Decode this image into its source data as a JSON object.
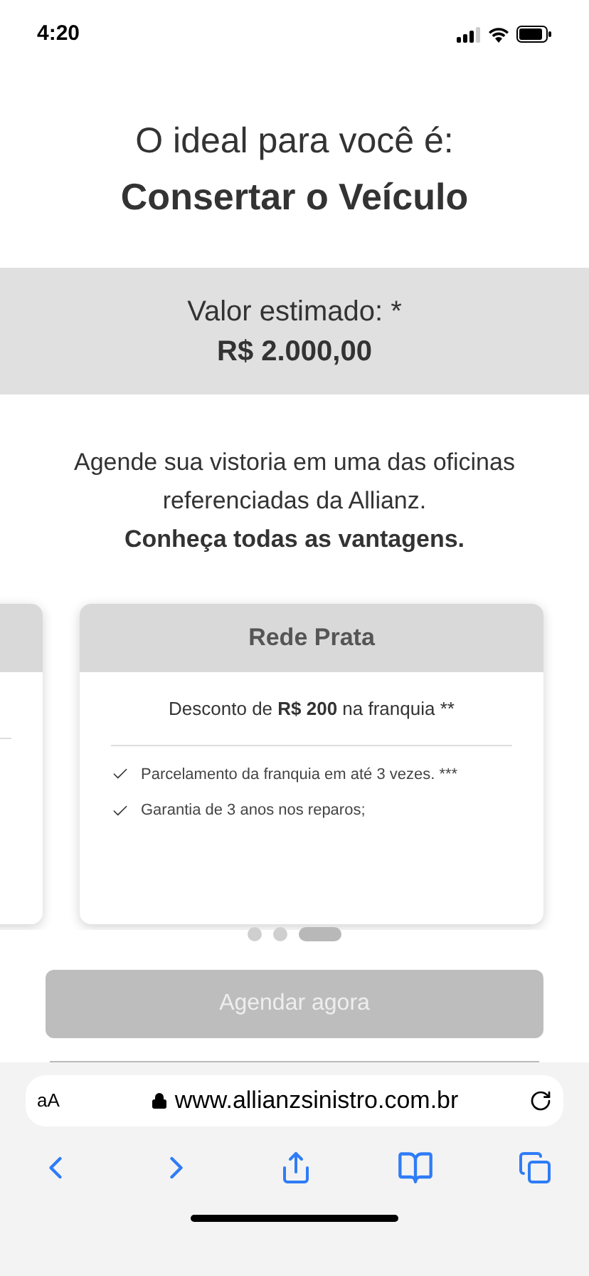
{
  "status_bar": {
    "time": "4:20"
  },
  "heading": {
    "line_1": "O ideal para você é:",
    "line_2": "Consertar o Veículo"
  },
  "estimate": {
    "label": "Valor estimado: *",
    "value": "R$ 2.000,00"
  },
  "intro": {
    "text": "Agende sua vistoria em uma das oficinas referenciadas da Allianz.",
    "link": "Conheça todas as vantagens."
  },
  "cards": [
    {
      "kind": "partial"
    },
    {
      "kind": "full",
      "title": "Rede Prata",
      "discount": {
        "prefix": "Desconto de ",
        "amount": "R$ 200",
        "suffix": " na franquia **"
      },
      "benefits": [
        "Parcelamento da franquia em até 3 vezes. ***",
        "Garantia de 3 anos nos reparos;"
      ]
    }
  ],
  "pager": [
    {
      "selected": false
    },
    {
      "selected": false
    },
    {
      "selected": true
    }
  ],
  "schedule_button": {
    "label": "Agendar agora",
    "disabled": true
  },
  "browser": {
    "text_size": "aA",
    "url": "www.allianzsinistro.com.br"
  }
}
